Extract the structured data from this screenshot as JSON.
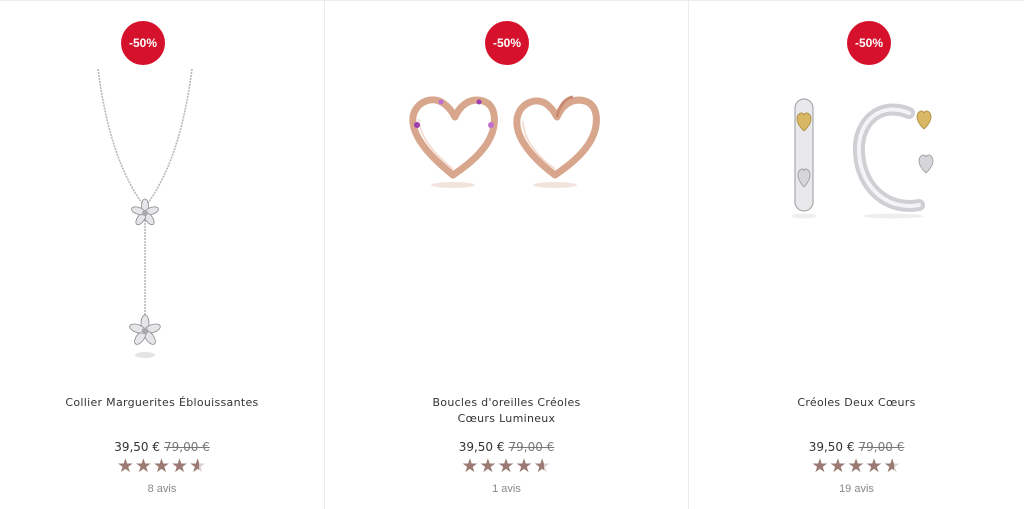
{
  "products": [
    {
      "badge": "-50%",
      "name": "Collier Marguerites Éblouissantes",
      "price": "39,50 €",
      "old_price": "79,00 €",
      "rating": 4.5,
      "reviews": "8 avis"
    },
    {
      "badge": "-50%",
      "name": "Boucles d'oreilles Créoles Cœurs Lumineux",
      "price": "39,50 €",
      "old_price": "79,00 €",
      "rating": 4.5,
      "reviews": "1 avis"
    },
    {
      "badge": "-50%",
      "name": "Créoles Deux Cœurs",
      "price": "39,50 €",
      "old_price": "79,00 €",
      "rating": 4.5,
      "reviews": "19 avis"
    }
  ],
  "colors": {
    "badge": "#d6112c",
    "star": "#9a7a72"
  }
}
